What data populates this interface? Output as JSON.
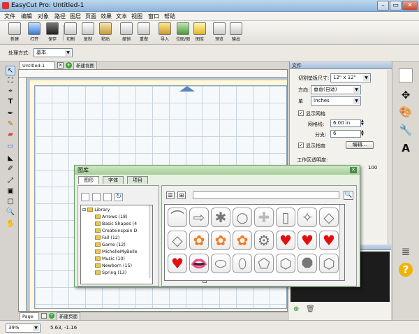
{
  "window": {
    "title": "EasyCut Pro: Untitled-1"
  },
  "menu": [
    "文件",
    "编辑",
    "对象",
    "路径",
    "图层",
    "页面",
    "效果",
    "文本",
    "视图",
    "窗口",
    "帮助"
  ],
  "toolbar": [
    {
      "label": "新建",
      "icon": "new-file-icon"
    },
    {
      "label": "打开",
      "icon": "open-icon"
    },
    {
      "label": "保存",
      "icon": "save-icon"
    },
    {
      "label": "切割",
      "icon": "cut-icon"
    },
    {
      "label": "复制",
      "icon": "copy-icon"
    },
    {
      "label": "粘贴",
      "icon": "paste-icon"
    },
    {
      "label": "撤销",
      "icon": "undo-icon"
    },
    {
      "label": "重做",
      "icon": "redo-icon"
    },
    {
      "label": "导入",
      "icon": "import-icon"
    },
    {
      "label": "位图/图",
      "icon": "bitmap-icon"
    },
    {
      "label": "图库",
      "icon": "library-icon"
    },
    {
      "label": "预览",
      "icon": "preview-icon"
    },
    {
      "label": "输出",
      "icon": "output-icon"
    }
  ],
  "process": {
    "label": "处理方式:",
    "value": "基本"
  },
  "doc": {
    "tab": "Untitled-1",
    "new_tab": "新建视图",
    "page_tab": "Page 1",
    "new_page": "新建页面"
  },
  "panel": {
    "title": "文件",
    "mat_size_label": "切割垫板尺寸:",
    "mat_size_value": "12\" x 12\"",
    "orientation_label": "方向:",
    "orientation_value": "垂直(自适)",
    "unit_label": "单",
    "unit_value": "Inches",
    "show_grid_label": "显示网格",
    "grid_spacing_label": "网格线:",
    "grid_spacing_value": "6.00 in",
    "divisions_label": "分支:",
    "divisions_value": "6",
    "show_guides_label": "显示指南",
    "edit_button": "编辑...",
    "transparency_label": "工作区透明度:",
    "transparency_value": "100"
  },
  "library": {
    "title": "图库",
    "tabs": [
      "图形",
      "字体",
      "项目"
    ],
    "root": "Library",
    "items": [
      "Arrows (18)",
      "Basic Shapes (4",
      "Createinspain D",
      "Fall (12)",
      "Game (12)",
      "MichelleMyBelle",
      "Music (10)",
      "Newborn (15)",
      "Spring (13)"
    ],
    "shapes": [
      {
        "name": "arch",
        "g": "⌒",
        "c": "#777"
      },
      {
        "name": "arrow",
        "g": "⇨",
        "c": "#777"
      },
      {
        "name": "asterisk",
        "g": "✱",
        "c": "#777"
      },
      {
        "name": "circle",
        "g": "○",
        "c": "#777"
      },
      {
        "name": "cross",
        "g": "✚",
        "c": "#bbb"
      },
      {
        "name": "rounded-rect",
        "g": "▯",
        "c": "#777"
      },
      {
        "name": "star-4",
        "g": "✧",
        "c": "#777"
      },
      {
        "name": "diamond",
        "g": "◇",
        "c": "#777"
      },
      {
        "name": "diamond",
        "g": "◇",
        "c": "#777"
      },
      {
        "name": "flower",
        "g": "✿",
        "c": "#f47b1f"
      },
      {
        "name": "flower",
        "g": "✿",
        "c": "#f47b1f"
      },
      {
        "name": "flower",
        "g": "✿",
        "c": "#f47b1f"
      },
      {
        "name": "gear",
        "g": "⚙",
        "c": "#777"
      },
      {
        "name": "heart",
        "g": "♥",
        "c": "#e01010"
      },
      {
        "name": "heart",
        "g": "♥",
        "c": "#e01010"
      },
      {
        "name": "heart",
        "g": "♥",
        "c": "#e01010"
      },
      {
        "name": "heart",
        "g": "♥",
        "c": "#e01010"
      },
      {
        "name": "lips",
        "g": "👄",
        "c": "#e01010"
      },
      {
        "name": "oval",
        "g": "⬭",
        "c": "#777"
      },
      {
        "name": "oval-tall",
        "g": "⬯",
        "c": "#777"
      },
      {
        "name": "pentagon",
        "g": "⬠",
        "c": "#777"
      },
      {
        "name": "hexagon",
        "g": "⬡",
        "c": "#777"
      },
      {
        "name": "octagon",
        "g": "⯃",
        "c": "#777"
      },
      {
        "name": "shape",
        "g": "⬡",
        "c": "#777"
      }
    ]
  },
  "status": {
    "zoom": "39%",
    "coords": "5.63, -1.16"
  }
}
